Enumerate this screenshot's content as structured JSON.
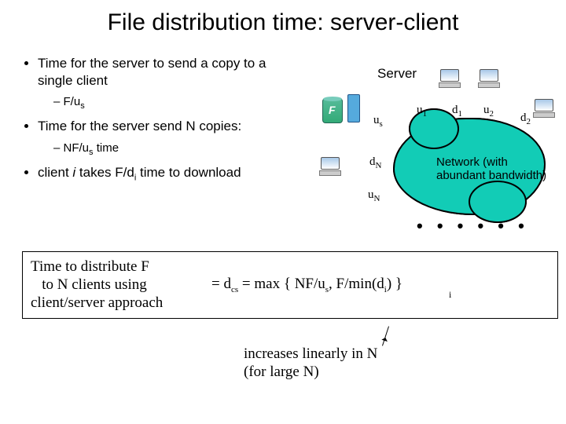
{
  "title": "File distribution time: server-client",
  "bullets": {
    "b1": "Time for the server to send a copy to a single client",
    "b1a": "F/u",
    "b1a_sub": "s",
    "b2": "Time for the server send N copies:",
    "b2a": "NF/u",
    "b2a_sub": "s",
    "b2a_suffix": " time",
    "b3_prefix": "client ",
    "b3_i": "i",
    "b3_mid": " takes F/d",
    "b3_sub": "i",
    "b3_suffix": " time to download"
  },
  "diagram": {
    "server": "Server",
    "file": "F",
    "us": "u",
    "us_sub": "s",
    "dn": "d",
    "dn_sub": "N",
    "un": "u",
    "un_sub": "N",
    "u1": "u",
    "u1_sub": "1",
    "d1": "d",
    "d1_sub": "1",
    "u2": "u",
    "u2_sub": "2",
    "d2": "d",
    "d2_sub": "2",
    "network1": "Network (with",
    "network2": "abundant bandwidth)"
  },
  "formula": {
    "lhs1": "Time to  distribute F",
    "lhs2": "   to N clients using",
    "lhs3": "client/server approach",
    "rhs": " = d",
    "rhs_sub": "cs",
    "rhs2": " = max { NF/u",
    "rhs2_sub": "s",
    "rhs3": ", F/min(d",
    "rhs3_sub": "i",
    "rhs4": ") }",
    "mini_i": "i"
  },
  "footnote": {
    "l1": "increases linearly in N",
    "l2": "(for large N)"
  }
}
